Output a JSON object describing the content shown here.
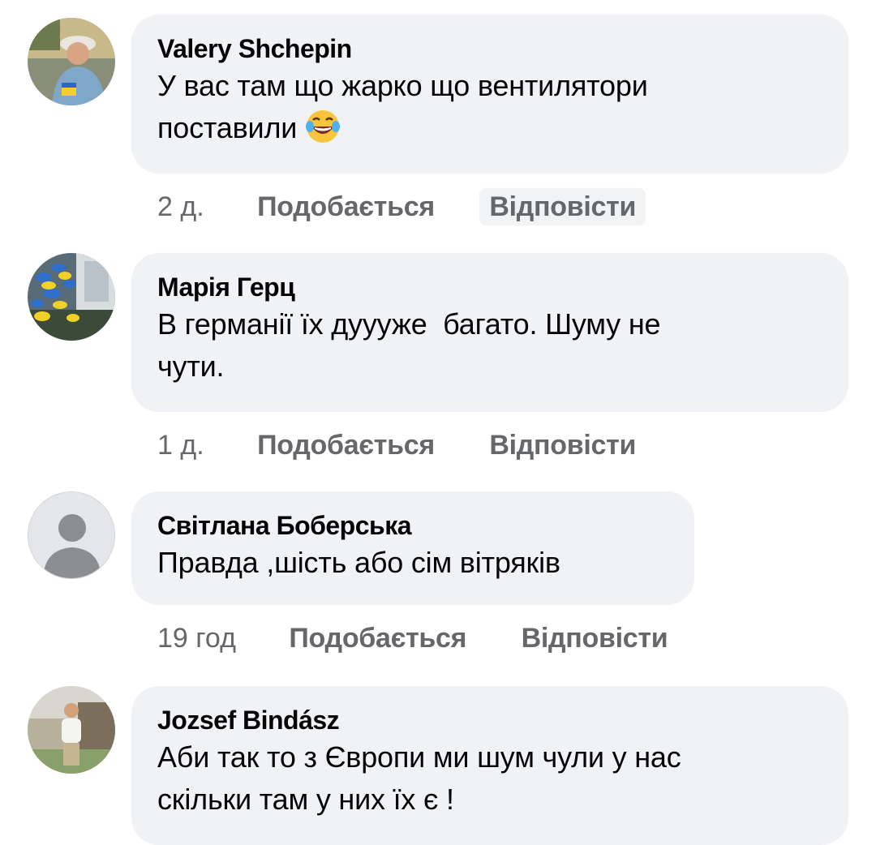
{
  "comments": [
    {
      "author": "Valery Shchepin",
      "text_lines": [
        "У вас там що жарко що вентилятори",
        "поставили"
      ],
      "emoji": "tears-of-joy-emoji",
      "time": "2 д.",
      "like_label": "Подобається",
      "reply_label": "Відповісти",
      "avatar": "user-photo"
    },
    {
      "author": "Марія Герц",
      "text_lines": [
        "В германії їх дуууже  багато. Шуму не",
        "чути."
      ],
      "time": "1 д.",
      "like_label": "Подобається",
      "reply_label": "Відповісти",
      "avatar": "flowers-photo"
    },
    {
      "author": "Світлана Боберська",
      "text_lines": [
        "Правда ,шість або сім вітряків"
      ],
      "time": "19 год",
      "like_label": "Подобається",
      "reply_label": "Відповісти",
      "avatar": "default-avatar"
    },
    {
      "author": "Jozsef Bindász",
      "text_lines": [
        "Аби так то з Європи ми шум чули у нас",
        "скільки там у них їх є !"
      ],
      "avatar": "user-photo"
    }
  ],
  "colors": {
    "bubble": "#f0f2f5",
    "meta_text": "#65676b",
    "text": "#050505"
  }
}
